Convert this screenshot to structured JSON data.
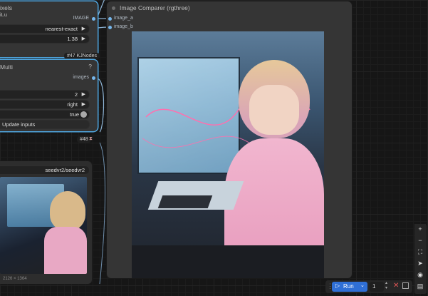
{
  "node_a": {
    "title": "ixels",
    "subtitle": "iLu",
    "output_label": "IMAGE",
    "method": "nearest-exact",
    "scale": "1.38",
    "badge": "#47 KJNodes"
  },
  "node_b": {
    "title": "Multi",
    "help": "?",
    "output_label": "images",
    "count": "2",
    "direction": "right",
    "toggle": "true",
    "update_label": "Update inputs",
    "badge": "#48"
  },
  "node_c": {
    "model": "seedvr2/seedvr2",
    "resolution": "2126 × 1364"
  },
  "comparer": {
    "title": "Image Comparer (rgthree)",
    "input_a": "image_a",
    "input_b": "image_b"
  },
  "toolbar": {
    "run_label": "Run",
    "queue_count": "1"
  },
  "side_tools": [
    "zoom-in-icon",
    "zoom-out-icon",
    "fit-view-icon",
    "select-icon",
    "eye-icon",
    "minimap-icon"
  ]
}
